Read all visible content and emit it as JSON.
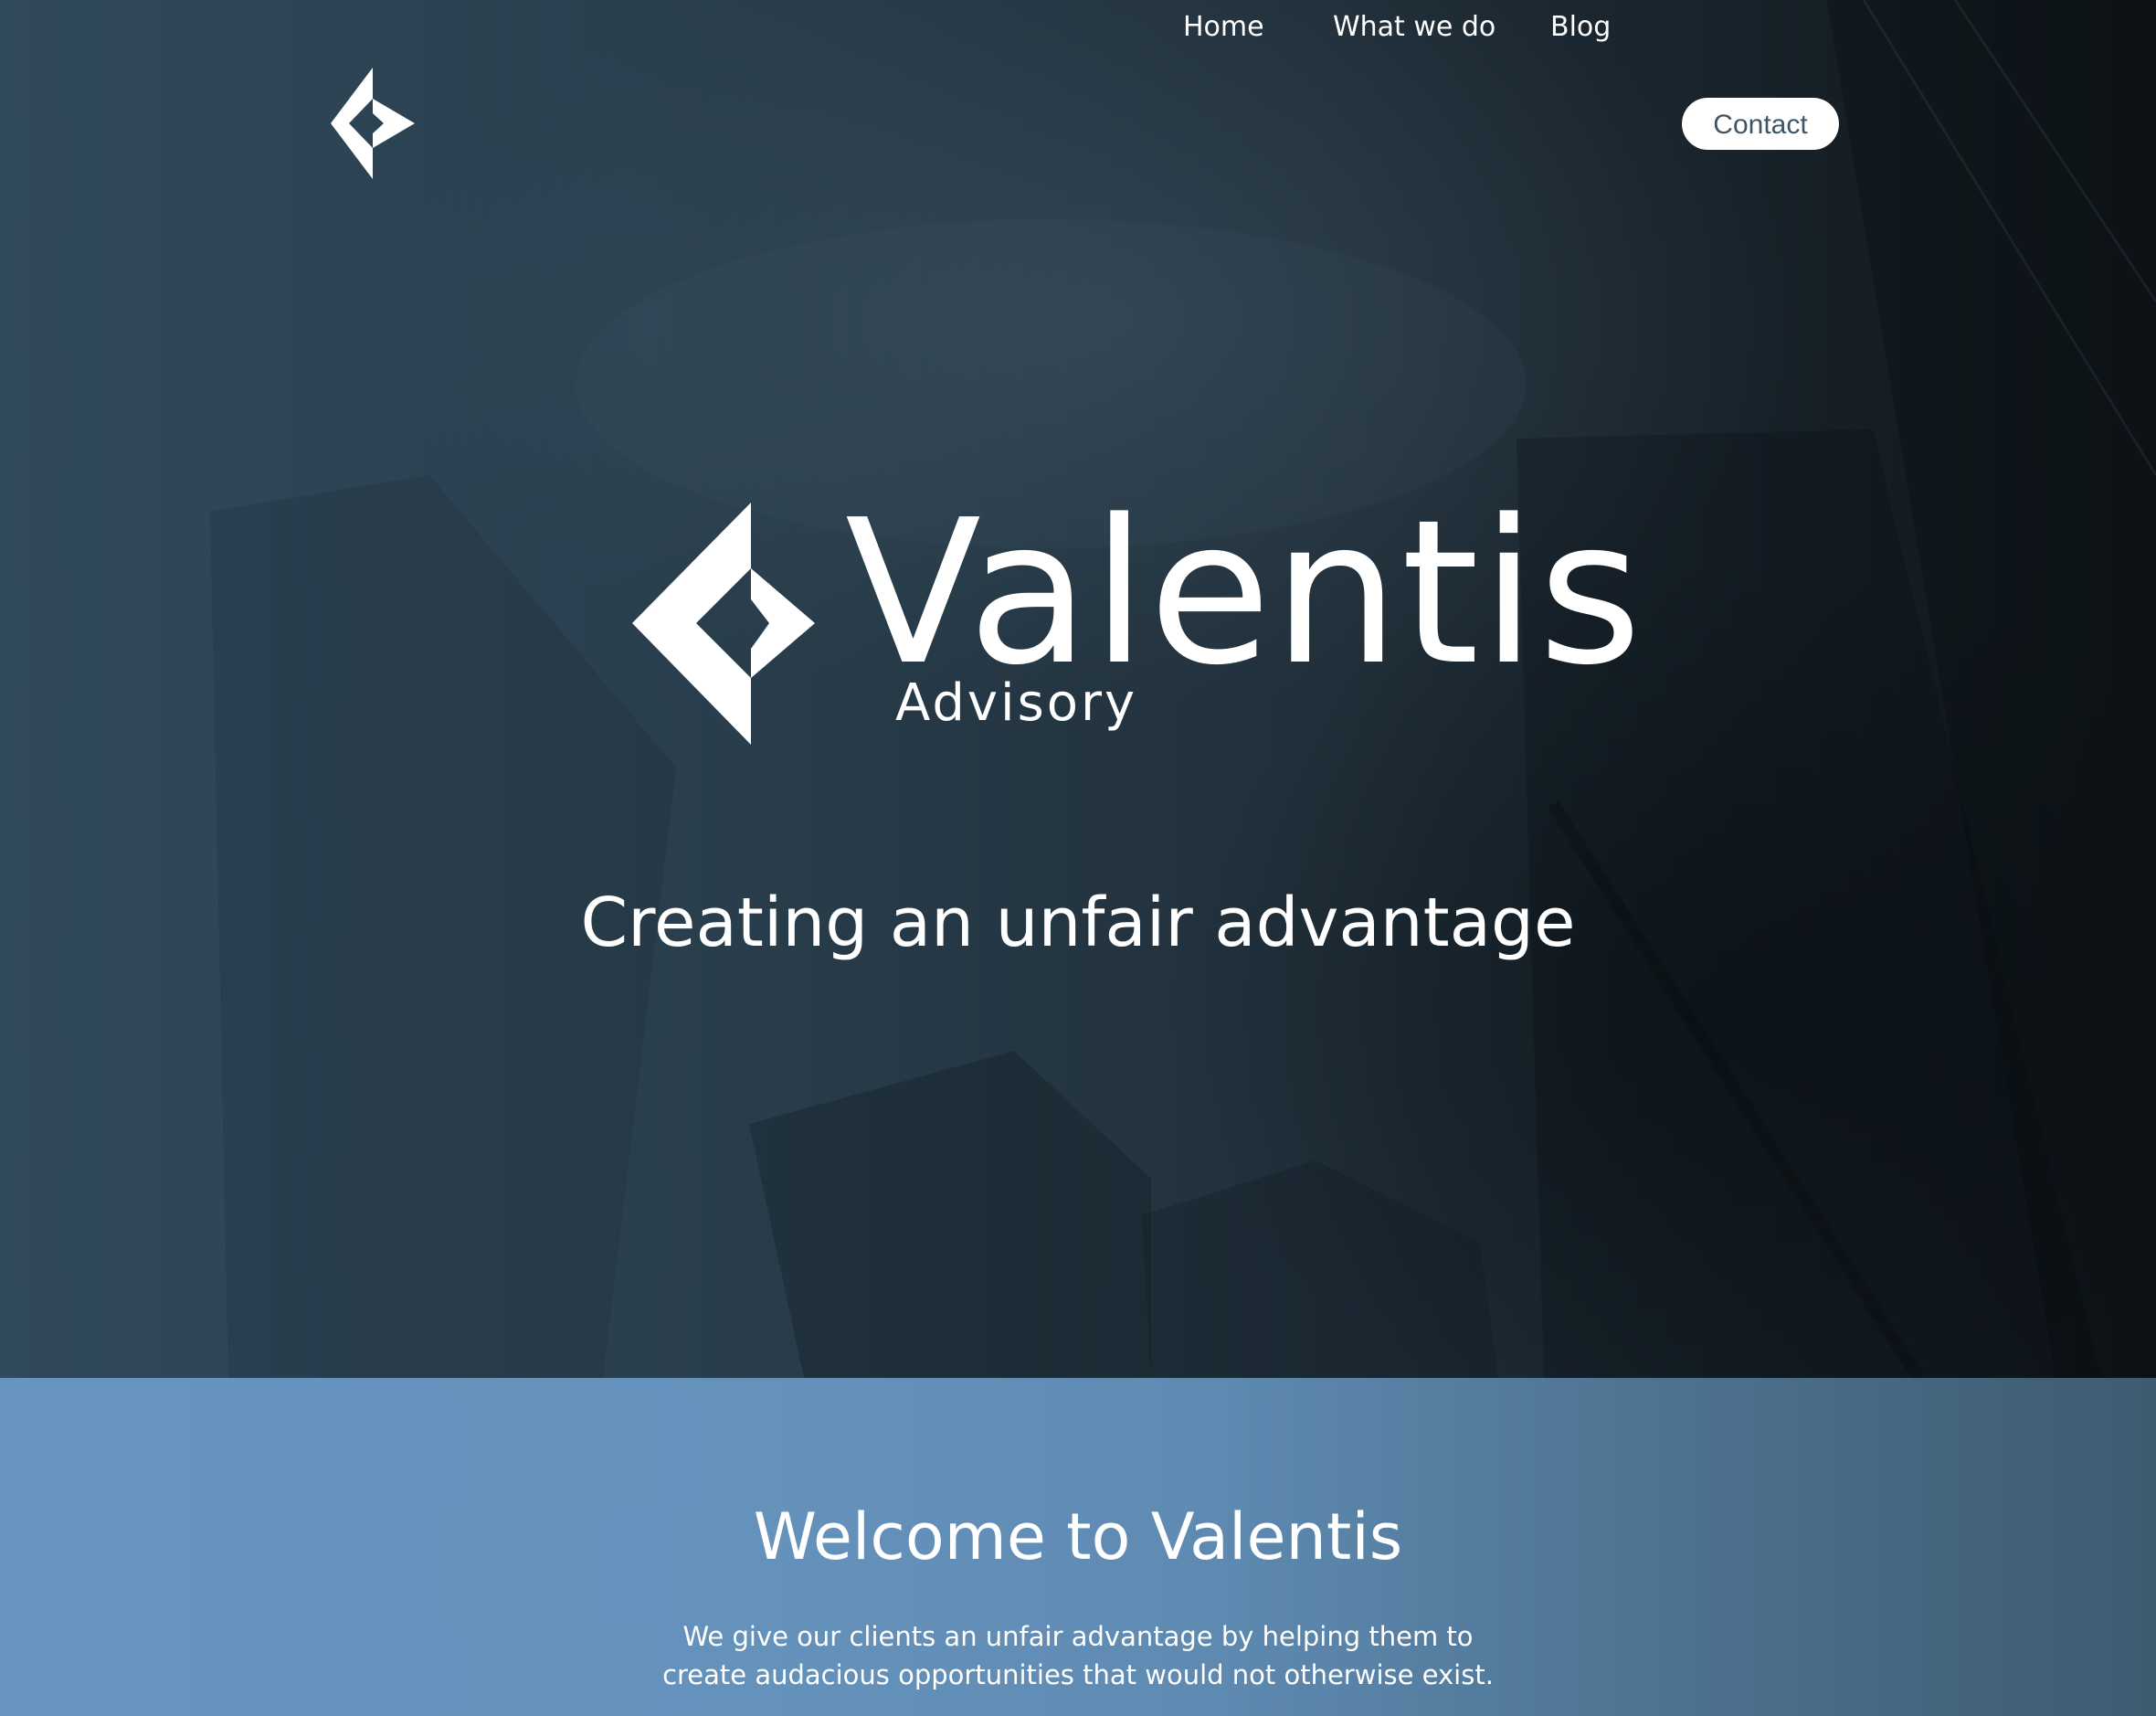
{
  "header": {
    "logo_icon": "valentis-diamond-logo",
    "nav": {
      "home_label": "Home",
      "what_we_do_label": "What we do",
      "blog_label": "Blog",
      "contact_label": "Contact"
    }
  },
  "hero": {
    "brand_name": "Valentis",
    "brand_subtitle": "Advisory",
    "tagline": "Creating an unfair advantage"
  },
  "welcome": {
    "title": "Welcome to Valentis",
    "text_line1": "We give our clients an unfair advantage by helping them to",
    "text_line2": "create audacious opportunities that would not otherwise exist."
  },
  "colors": {
    "hero_left": "#30495b",
    "hero_right": "#0f151a",
    "welcome_left": "#6794bf",
    "welcome_right": "#3e5b70",
    "contact_text": "#3e5565",
    "white": "#ffffff"
  }
}
